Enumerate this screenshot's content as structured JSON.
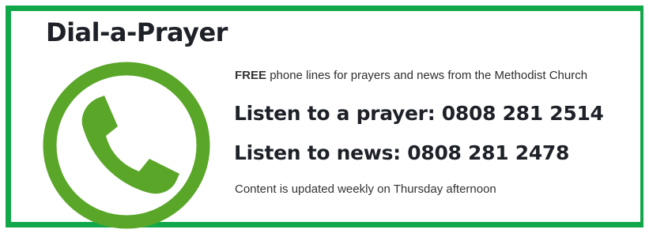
{
  "title": "Dial-a-Prayer",
  "icon": "phone-handset-in-circle-icon",
  "colors": {
    "frame": "#12a84a",
    "icon": "#5aa629",
    "text_dark": "#1e2228"
  },
  "intro": {
    "bold": "FREE",
    "rest": "phone lines for prayers and news from the Methodist Church"
  },
  "lines": {
    "prayer": "Listen to a prayer: 0808 281 2514",
    "news": "Listen to news: 0808 281 2478"
  },
  "footnote": "Content is updated weekly on Thursday afternoon"
}
